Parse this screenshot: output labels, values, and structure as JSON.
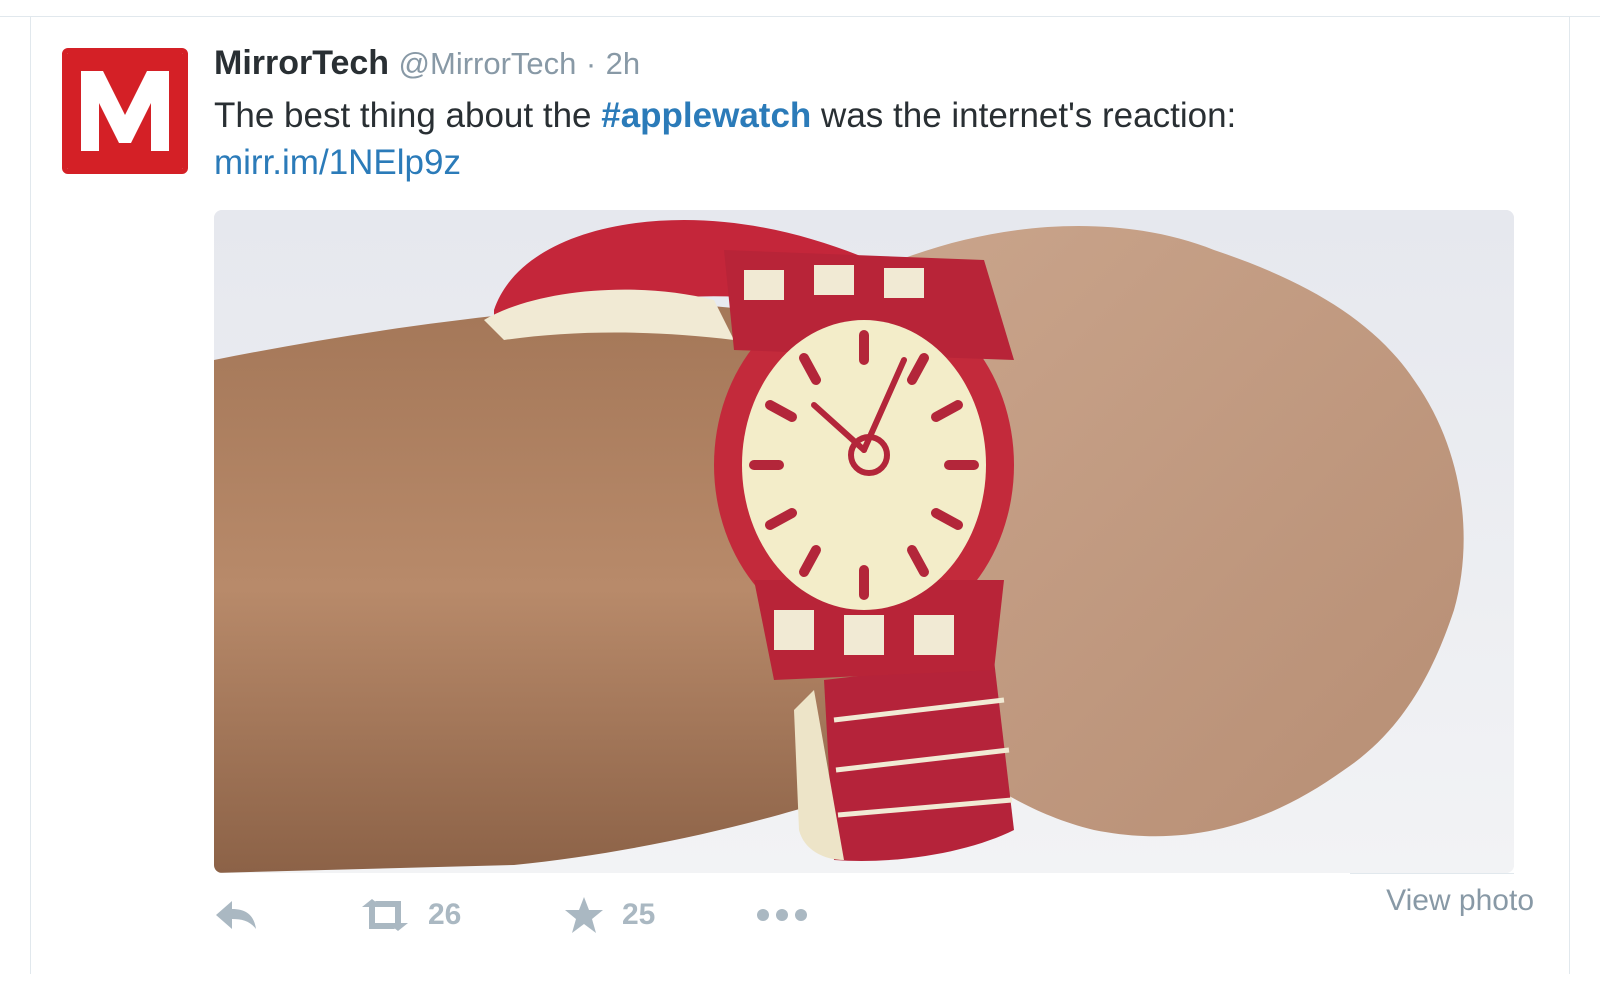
{
  "tweet": {
    "display_name": "MirrorTech",
    "handle": "@MirrorTech",
    "separator": "·",
    "time": "2h",
    "text_before": "The best thing about the ",
    "hashtag": "#applewatch",
    "text_after": " was the internet's reaction:",
    "link": "mirr.im/1NElp9z",
    "avatar_letter": "M"
  },
  "actions": {
    "reply_icon": "reply-icon",
    "retweet_icon": "retweet-icon",
    "retweet_count": "26",
    "favorite_icon": "star-icon",
    "favorite_count": "25",
    "more_icon": "more-icon",
    "view_photo": "View photo"
  },
  "colors": {
    "brand_red": "#d42026",
    "link_blue": "#2b7bb9",
    "muted_gray": "#8899a6",
    "icon_gray": "#aab8c2"
  }
}
